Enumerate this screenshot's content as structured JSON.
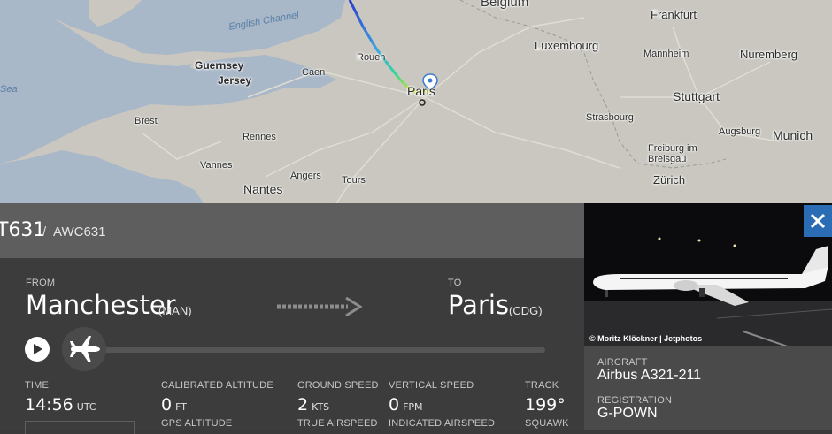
{
  "map": {
    "sea_label_channel": "English Channel",
    "sea_label_left": "Sea",
    "places": {
      "belgium": "Belgium",
      "frankfurt": "Frankfurt",
      "luxembourg": "Luxembourg",
      "mannheim": "Mannheim",
      "nuremberg": "Nuremberg",
      "guernsey": "Guernsey",
      "jersey": "Jersey",
      "caen": "Caen",
      "rouen": "Rouen",
      "paris": "Paris",
      "stuttgart": "Stuttgart",
      "brest": "Brest",
      "rennes": "Rennes",
      "strasbourg": "Strasbourg",
      "augsburg": "Augsburg",
      "munich": "Munich",
      "freiburg": "Freiburg im Breisgau",
      "vannes": "Vannes",
      "nantes": "Nantes",
      "angers": "Angers",
      "tours": "Tours",
      "zurich": "Zürich"
    },
    "colors": {
      "land": "#c9c7bf",
      "sea": "#a9b8c8",
      "track_start": "#2a3bd0",
      "track_end": "#d8e02c"
    }
  },
  "flight": {
    "callsign": "T631",
    "separator": "/",
    "icao": "AWC631"
  },
  "route": {
    "from_label": "FROM",
    "from_city": "Manchester",
    "from_code": "(MAN)",
    "to_label": "TO",
    "to_city": "Paris",
    "to_code": "(CDG)",
    "progress": 0.0
  },
  "stats": {
    "time": {
      "label": "TIME",
      "value": "14:56",
      "unit": "UTC"
    },
    "calibrated_altitude": {
      "label": "CALIBRATED ALTITUDE",
      "value": "0",
      "unit": "FT"
    },
    "gps_altitude": {
      "label": "GPS ALTITUDE"
    },
    "ground_speed": {
      "label": "GROUND SPEED",
      "value": "2",
      "unit": "KTS"
    },
    "true_airspeed": {
      "label": "TRUE AIRSPEED"
    },
    "vertical_speed": {
      "label": "VERTICAL SPEED",
      "value": "0",
      "unit": "FPM"
    },
    "indicated_airspeed": {
      "label": "INDICATED AIRSPEED"
    },
    "track": {
      "label": "TRACK",
      "value": "199°"
    },
    "squawk": {
      "label": "SQUAWK"
    }
  },
  "aircraft": {
    "photo_credit": "© Moritz Klöckner | Jetphotos",
    "aircraft_label": "AIRCRAFT",
    "aircraft_value": "Airbus A321-211",
    "registration_label": "REGISTRATION",
    "registration_value": "G-POWN"
  },
  "icons": {
    "play": "play-icon",
    "plane": "airplane-icon",
    "close": "close-icon",
    "arrow": "route-arrow-icon",
    "pin": "location-pin-icon"
  }
}
